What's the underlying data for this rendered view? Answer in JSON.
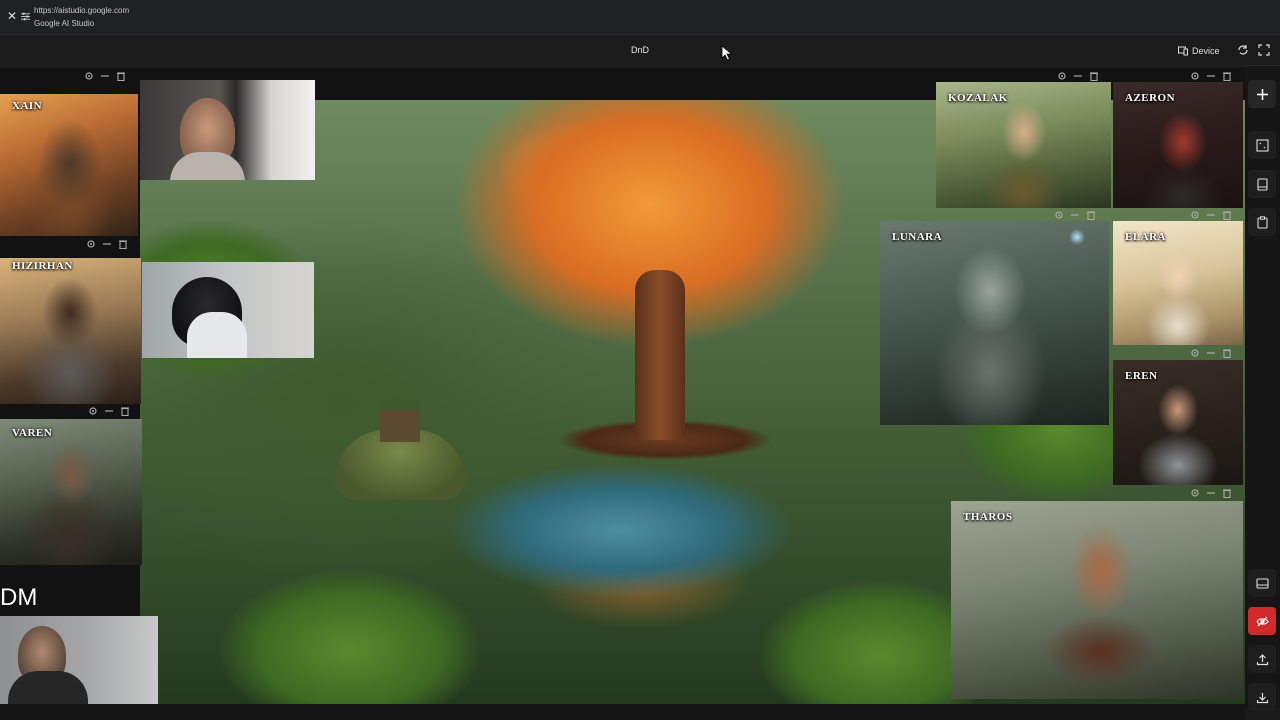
{
  "browser": {
    "url": "https://aistudio.google.com",
    "site_name": "Google AI Studio",
    "close_icon": "close-icon",
    "tune_icon": "tune-icon"
  },
  "app": {
    "title": "DnD",
    "device_label": "Device",
    "icons": [
      "device-icon",
      "refresh-icon",
      "fullscreen-icon"
    ]
  },
  "characters": {
    "xain": "XAIN",
    "hizirhan": "HIZIRHAN",
    "varen": "VAREN",
    "kozalak": "KOZALAK",
    "azeron": "AZERON",
    "lunara": "LUNARA",
    "elara": "ELARA",
    "eren": "EREN",
    "tharos": "THAROS"
  },
  "dm_label": "DM",
  "panel_controls": [
    "settings-icon",
    "minimize-icon",
    "delete-icon"
  ],
  "rail": [
    "add-icon",
    "grid-select-icon",
    "tablet-icon",
    "clipboard-icon",
    "panel-icon",
    "hide-icon",
    "upload-icon",
    "download-icon"
  ],
  "colors": {
    "accent_danger": "#d02a2a",
    "background": "#1a1a1a"
  }
}
